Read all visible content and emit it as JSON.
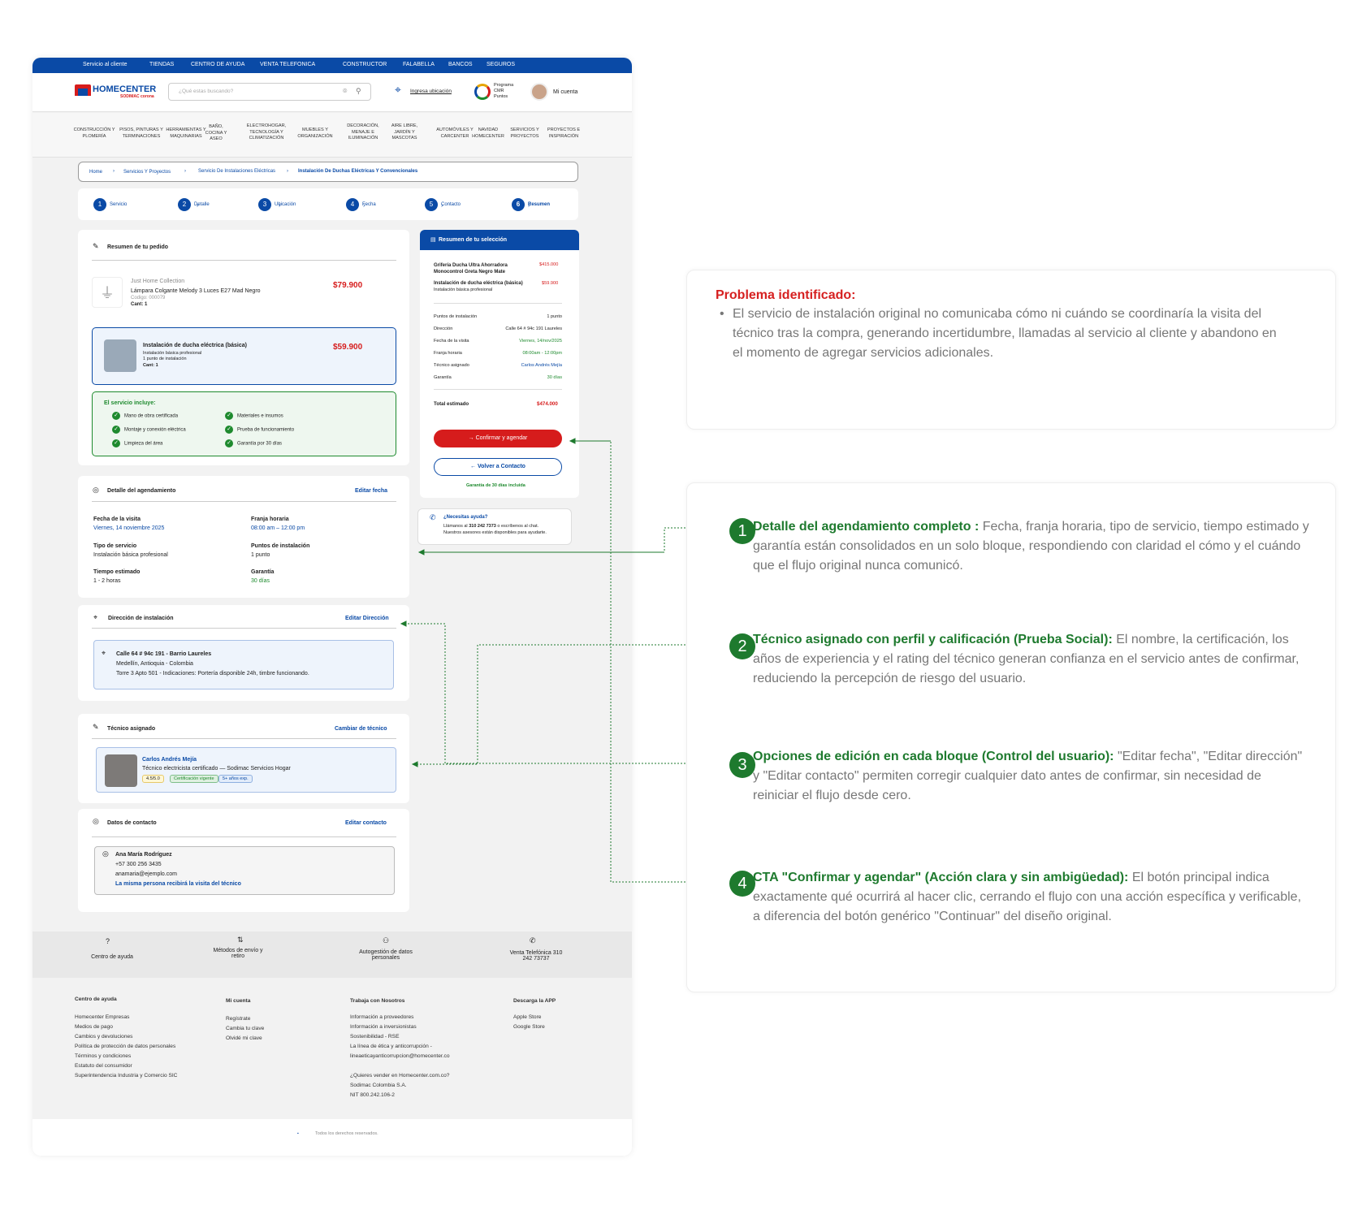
{
  "topbar": [
    "Servicio al cliente",
    "TIENDAS",
    "CENTRO DE AYUDA",
    "VENTA TELEFONICA",
    "CONSTRUCTOR",
    "FALABELLA",
    "BANCOS",
    "SEGUROS"
  ],
  "header": {
    "logo": "HOMECENTER",
    "logo_sub": "SODIMAC corona",
    "search_placeholder": "¿Qué estas buscando?",
    "location": "Ingresa ubicación",
    "cmr_label": "Programa CMR Puntos",
    "account": "Mi cuenta"
  },
  "categories": [
    "CONSTRUCCIÓN Y PLOMERÍA",
    "PISOS, PINTURAS Y TERMINACIONES",
    "HERRAMIENTAS Y MAQUINARIAS",
    "BAÑO, COCINA Y ASEO",
    "ELECTROHOGAR, TECNOLOGÍA Y CLIMATIZACIÓN",
    "MUEBLES Y ORGANIZACIÓN",
    "DECORACIÓN, MENAJE E ILUMINACIÓN",
    "AIRE LIBRE, JARDÍN Y MASCOTAS",
    "AUTOMÓVILES Y CARCENTER",
    "NAVIDAD HOMECENTER",
    "SERVICIOS Y PROYECTOS",
    "PROYECTOS E INSPIRACIÓN"
  ],
  "breadcrumb": [
    "Home",
    "Servicios Y Proyectos",
    "Servicio De Instalaciones Eléctricas",
    "Instalación De Duchas Eléctricas Y Convencionales"
  ],
  "steps": [
    {
      "n": "1",
      "label": "Servicio"
    },
    {
      "n": "2",
      "label": "Detalle"
    },
    {
      "n": "3",
      "label": "Ubicación"
    },
    {
      "n": "4",
      "label": "Fecha"
    },
    {
      "n": "5",
      "label": "Contacto"
    },
    {
      "n": "6",
      "label": "Resumen"
    }
  ],
  "order": {
    "title": "Resumen de tu pedido",
    "p1_brand": "Just Home Collection",
    "p1_name": "Lámpara Colgante Melody 3 Luces E27 Mad  Negro",
    "p1_code": "Codigo: 000079",
    "p1_qty": "Cant: 1",
    "p1_price": "$79.900",
    "p2_name": "Instalación de ducha eléctrica (básica)",
    "p2_d1": "Instalación básica profesional",
    "p2_d2": "1 punto de instalación",
    "p2_qty": "Cant: 1",
    "p2_price": "$59.900",
    "incl_title": "El servicio incluye:",
    "incl": [
      "Mano de obra certificada",
      "Materiales e insumos",
      "Montaje y conexión eléctrica",
      "Prueba de funcionamiento",
      "Limpieza del área",
      "Garantía por 30 días"
    ]
  },
  "schedule": {
    "title": "Detalle del agendamiento",
    "edit": "Editar fecha",
    "date_l": "Fecha de la visita",
    "date_v": "Viernes, 14 noviembre 2025",
    "slot_l": "Franja horaria",
    "slot_v": "08:00 am – 12:00 pm",
    "type_l": "Tipo de servicio",
    "type_v": "Instalación básica profesional",
    "pts_l": "Puntos de instalación",
    "pts_v": "1 punto",
    "time_l": "Tiempo estimado",
    "time_v": "1 - 2 horas",
    "war_l": "Garantía",
    "war_v": "30 días"
  },
  "address": {
    "title": "Dirección de instalación",
    "edit": "Editar Dirección",
    "l1": "Calle 64 # 94c 191 - Barrio Laureles",
    "l2": "Medellín, Antioquia - Colombia",
    "l3": "Torre 3 Apto 501 - Indicaciones: Portería disponible 24h, timbre funcionando."
  },
  "tech": {
    "title": "Técnico asignado",
    "edit": "Cambiar de técnico",
    "name": "Carlos Andrés Mejía",
    "role": "Técnico electricista certificado — Sodimac Servicios Hogar",
    "rating": "4.5/5.0",
    "cert": "Certificación vigente",
    "exp": "5+ años exp."
  },
  "contact": {
    "title": "Datos de contacto",
    "edit": "Editar contacto",
    "name": "Ana María Rodríguez",
    "phone": "+57 300 256 3435",
    "email": "anamaria@ejemplo.com",
    "note": "La misma persona recibirá la visita del técnico"
  },
  "summary": {
    "title": "Resumen de tu selección",
    "i1": "Grifería Ducha Ultra Ahorradora Monocontrol Greta Negro Mate",
    "i1p": "$415.000",
    "i2": "Instalación de ducha eléctrica (básica)",
    "i2s": "Instalación básica profesional",
    "i2p": "$59.900",
    "rows": [
      [
        "Puntos de instalación",
        "1 punto"
      ],
      [
        "Dirección",
        "Calle 64 # 94c 191 Laureles"
      ],
      [
        "Fecha de la visita",
        "Viernes, 14/nov/2025"
      ],
      [
        "Franja horaria",
        "08:00am - 12:00pm"
      ],
      [
        "Técnico asignado",
        "Carlos Andrés Mejía"
      ],
      [
        "Garantía",
        "30 días"
      ]
    ],
    "total_l": "Total estimado",
    "total_v": "$474.000",
    "confirm": "Confirmar y agendar",
    "back": "Volver a Contacto",
    "guarantee": "Garantía de 30 días incluida"
  },
  "help": {
    "title": "¿Necesitas ayuda?",
    "text1": "Llámanos al",
    "phone": "310 242 7373",
    "text2": "o escríbenos al chat.",
    "text3": "Nuestros asesores están disponibles para ayudarte."
  },
  "footer_icons": [
    "Centro de ayuda",
    "Métodos de envío y retiro",
    "Autogestión de datos personales",
    "Venta Telefónica 310 242 73737"
  ],
  "footer_cols": [
    {
      "title": "Centro de ayuda",
      "items": [
        "Homecenter Empresas",
        "Medios de pago",
        "Cambios y devoluciones",
        "Política de protección de datos personales",
        "Términos y condiciones",
        "Estatuto del consumidor",
        "Superintendencia Industria y Comercio SIC"
      ]
    },
    {
      "title": "Mi cuenta",
      "items": [
        "Regístrate",
        "Cambia tu clave",
        "Olvidé mi clave"
      ]
    },
    {
      "title": "Trabaja con Nosotros",
      "items": [
        "Información a proveedores",
        "Información a inversionistas",
        "Sostenibilidad - RSE",
        "La línea de ética y anticorrupción -",
        "lineaeticayanticorrupcion@homecenter.co",
        "",
        "¿Quieres vender en Homecenter.com.co?",
        "Sodimac Colombia S.A.",
        "NIT 800.242.106-2"
      ]
    },
    {
      "title": "Descarga la APP",
      "items": [
        "Apple Store",
        "Google Store"
      ]
    }
  ],
  "copyright": "Todos los derechos reservados.",
  "annotations": {
    "problem_title": "Problema identificado:",
    "problem_text": "El servicio de instalación original no comunicaba cómo ni cuándo se coordinaría la visita del técnico tras la compra, generando incertidumbre, llamadas al servicio al cliente y abandono en el momento de agregar servicios adicionales.",
    "items": [
      {
        "n": "1",
        "title": "Detalle del agendamiento completo :",
        "text": " Fecha, franja horaria, tipo de servicio, tiempo estimado y garantía están consolidados en un solo bloque, respondiendo con claridad el cómo y el cuándo que el flujo original nunca comunicó."
      },
      {
        "n": "2",
        "title": "Técnico asignado con perfil y calificación (Prueba Social):",
        "text": " El nombre, la certificación, los años de experiencia y el rating del técnico generan confianza en el servicio antes de confirmar, reduciendo la percepción de riesgo del usuario."
      },
      {
        "n": "3",
        "title": "Opciones de edición en cada bloque (Control del usuario):",
        "text": " \"Editar fecha\", \"Editar dirección\" y \"Editar contacto\" permiten corregir cualquier dato antes de confirmar, sin necesidad de reiniciar el flujo desde cero."
      },
      {
        "n": "4",
        "title": "CTA \"Confirmar y agendar\" (Acción clara y sin ambigüedad):",
        "text": " El botón principal indica exactamente qué ocurrirá al hacer clic, cerrando el flujo con una acción específica y verificable, a diferencia del botón genérico \"Continuar\" del diseño original."
      }
    ]
  },
  "colors": {
    "brand_blue": "#0a4aa6",
    "price_red": "#d61c1c",
    "annotation_green": "#1e7a2e",
    "problem_red": "#d62020"
  }
}
